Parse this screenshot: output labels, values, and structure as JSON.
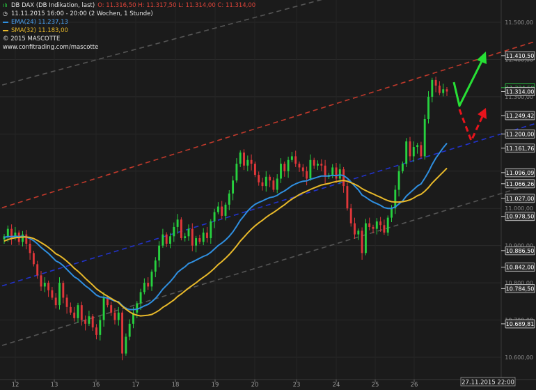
{
  "header": {
    "instrument": "DB DAX (DB Indikation, last)",
    "ohlc": "O: 11.316,50  H: 11.317,50  L: 11.314,00  C: 11.314,00",
    "period": "11.11.2015 16:00 - 20:00 (2 Wochen, 1 Stunde)",
    "ema_label": "EMA(24)  11.237,13",
    "sma_label": "SMA(32)  11.183,00",
    "copyright": "© 2015 MASCOTTE",
    "url": "www.confitrading.com/mascotte",
    "ema_color": "#2f8fe0",
    "sma_color": "#e8b92a",
    "icons": [
      "candlestick-icon",
      "clock-icon"
    ]
  },
  "chart_data": {
    "type": "line",
    "description_units": "DAX index points",
    "ylim": [
      10540,
      11560
    ],
    "x_tick_labels": [
      "12",
      "13",
      "16",
      "17",
      "18",
      "19",
      "20",
      "23",
      "24",
      "25",
      "26"
    ],
    "x_label_footer": "27.11.2015 22:00",
    "y_grid_ticks": [
      "11.500,00",
      "11.400,00",
      "11.300,00",
      "11.200,00",
      "11.100,00",
      "11.000,00",
      "10.900,00",
      "10.800,00",
      "10.700,00",
      "10.600,00"
    ],
    "y_grid_values": [
      11500,
      11400,
      11300,
      11200,
      11100,
      11000,
      10900,
      10800,
      10700,
      10600
    ],
    "price_tags": [
      {
        "label": "11.410,50",
        "value": 11410.5,
        "color": "#ffffff",
        "bg": "#303030",
        "border": "#cfcfcf"
      },
      {
        "label": "11.324,50",
        "value": 11324.5,
        "color": "#2fd04a",
        "bg": "#1b1b1b",
        "border": "#2fd04a"
      },
      {
        "label": "11.314,00",
        "value": 11314.0,
        "color": "#ffffff",
        "bg": "#303030",
        "border": "#cfcfcf"
      },
      {
        "label": "11.249,42",
        "value": 11249.42,
        "color": "#ffffff",
        "bg": "#303030",
        "border": "#cfcfcf"
      },
      {
        "label": "11.200,00",
        "value": 11200.0,
        "color": "#ffffff",
        "bg": "#303030",
        "border": "#cfcfcf"
      },
      {
        "label": "11.161,76",
        "value": 11161.76,
        "color": "#ffffff",
        "bg": "#303030",
        "border": "#cfcfcf"
      },
      {
        "label": "11.096,09",
        "value": 11096.09,
        "color": "#ffffff",
        "bg": "#303030",
        "border": "#cfcfcf"
      },
      {
        "label": "11.066,26",
        "value": 11066.26,
        "color": "#ffffff",
        "bg": "#303030",
        "border": "#cfcfcf"
      },
      {
        "label": "11.027,00",
        "value": 11027.0,
        "color": "#ffffff",
        "bg": "#303030",
        "border": "#cfcfcf"
      },
      {
        "label": "10.978,50",
        "value": 10978.5,
        "color": "#ffffff",
        "bg": "#303030",
        "border": "#cfcfcf"
      },
      {
        "label": "10.886,50",
        "value": 10886.5,
        "color": "#ffffff",
        "bg": "#303030",
        "border": "#cfcfcf"
      },
      {
        "label": "10.842,00",
        "value": 10842.0,
        "color": "#ffffff",
        "bg": "#303030",
        "border": "#cfcfcf"
      },
      {
        "label": "10.784,50",
        "value": 10784.5,
        "color": "#ffffff",
        "bg": "#303030",
        "border": "#cfcfcf"
      },
      {
        "label": "10.689,81",
        "value": 10689.81,
        "color": "#ffffff",
        "bg": "#303030",
        "border": "#cfcfcf"
      }
    ],
    "candle_colors": {
      "up": "#27d13f",
      "down": "#e0373a"
    },
    "closes": [
      10925,
      10945,
      10920,
      10935,
      10910,
      10930,
      10905,
      10880,
      10850,
      10820,
      10790,
      10800,
      10780,
      10760,
      10740,
      10800,
      10760,
      10735,
      10720,
      10705,
      10740,
      10700,
      10690,
      10710,
      10680,
      10660,
      10700,
      10760,
      10740,
      10720,
      10700,
      10720,
      10610,
      10655,
      10690,
      10720,
      10745,
      10775,
      10800,
      10790,
      10830,
      10860,
      10900,
      10930,
      10905,
      10925,
      10950,
      10970,
      10920,
      10925,
      10945,
      10900,
      10920,
      10910,
      10935,
      10920,
      10965,
      10990,
      11005,
      10980,
      11010,
      11040,
      11075,
      11120,
      11150,
      11115,
      11130,
      11120,
      11090,
      11070,
      11060,
      11085,
      11075,
      11050,
      11080,
      11120,
      11100,
      11130,
      11140,
      11120,
      11110,
      11100,
      11080,
      11130,
      11115,
      11120,
      11115,
      11085,
      11090,
      11110,
      11080,
      11105,
      11060,
      11000,
      10960,
      10930,
      10940,
      10880,
      10960,
      10950,
      10945,
      10965,
      10955,
      10935,
      10975,
      11000,
      11050,
      11100,
      11120,
      11180,
      11140,
      11165,
      11170,
      11140,
      11240,
      11300,
      11345,
      11330,
      11310,
      11320,
      11314
    ],
    "ema24": [
      10922,
      10924,
      10924,
      10925,
      10924,
      10925,
      10923,
      10919,
      10913,
      10905,
      10895,
      10887,
      10879,
      10869,
      10859,
      10854,
      10846,
      10836,
      10826,
      10816,
      10810,
      10801,
      10792,
      10785,
      10776,
      10767,
      10762,
      10761,
      10759,
      10755,
      10751,
      10749,
      10739,
      10731,
      10728,
      10728,
      10729,
      10733,
      10738,
      10742,
      10749,
      10758,
      10770,
      10783,
      10793,
      10803,
      10815,
      10828,
      10836,
      10843,
      10852,
      10856,
      10861,
      10866,
      10871,
      10875,
      10882,
      10891,
      10900,
      10907,
      10915,
      10925,
      10937,
      10952,
      10968,
      10980,
      10993,
      11003,
      11011,
      11016,
      11020,
      11025,
      11029,
      11031,
      11035,
      11042,
      11047,
      11054,
      11061,
      11066,
      11070,
      11073,
      11074,
      11078,
      11081,
      11084,
      11087,
      11087,
      11087,
      11089,
      11088,
      11090,
      11088,
      11081,
      11071,
      11060,
      11050,
      11036,
      11030,
      11023,
      11017,
      11013,
      11008,
      11002,
      11000,
      11000,
      11004,
      11012,
      11020,
      11033,
      11042,
      11051,
      11060,
      11066,
      11081,
      11098,
      11118,
      11135,
      11149,
      11163,
      11175
    ],
    "sma32": [
      10912,
      10916,
      10919,
      10921,
      10922,
      10923,
      10923,
      10922,
      10919,
      10914,
      10908,
      10902,
      10895,
      10887,
      10878,
      10873,
      10866,
      10858,
      10849,
      10839,
      10831,
      10822,
      10812,
      10803,
      10794,
      10784,
      10777,
      10770,
      10764,
      10758,
      10752,
      10747,
      10737,
      10729,
      10722,
      10716,
      10713,
      10711,
      10712,
      10713,
      10715,
      10720,
      10726,
      10734,
      10740,
      10747,
      10754,
      10763,
      10770,
      10778,
      10786,
      10793,
      10800,
      10808,
      10815,
      10822,
      10830,
      10839,
      10849,
      10857,
      10866,
      10876,
      10887,
      10899,
      10912,
      10923,
      10934,
      10944,
      10953,
      10961,
      10968,
      10976,
      10983,
      10989,
      10996,
      11003,
      11010,
      11018,
      11025,
      11031,
      11037,
      11042,
      11046,
      11051,
      11055,
      11059,
      11063,
      11065,
      11067,
      11070,
      11072,
      11074,
      11075,
      11073,
      11069,
      11065,
      11060,
      11053,
      11048,
      11043,
      11039,
      11034,
      11030,
      11025,
      11021,
      11018,
      11017,
      11017,
      11018,
      11020,
      11023,
      11028,
      11034,
      11038,
      11046,
      11056,
      11068,
      11078,
      11088,
      11098,
      11108
    ],
    "trend_lines": [
      {
        "name": "upper-resistance",
        "style": "dashed",
        "color": "#c0392b",
        "from": [
          0,
          11000
        ],
        "to": [
          120,
          11420
        ]
      },
      {
        "name": "middle-support",
        "style": "dashed",
        "color": "#2233cc",
        "from": [
          0,
          10790
        ],
        "to": [
          120,
          11200
        ]
      },
      {
        "name": "top-channel",
        "style": "dashed",
        "color": "#555555",
        "from": [
          0,
          11330
        ],
        "to": [
          120,
          11690
        ]
      },
      {
        "name": "lower-channel",
        "style": "dashed",
        "color": "#555555",
        "from": [
          0,
          10630
        ],
        "to": [
          120,
          11040
        ]
      }
    ],
    "annotations": [
      {
        "name": "bullish-forecast-arrow",
        "color": "#27e035",
        "style": "solid"
      },
      {
        "name": "bearish-forecast-arrow",
        "color": "#e8141c",
        "style": "dashed"
      }
    ],
    "grid": true,
    "legend": "top-left"
  }
}
